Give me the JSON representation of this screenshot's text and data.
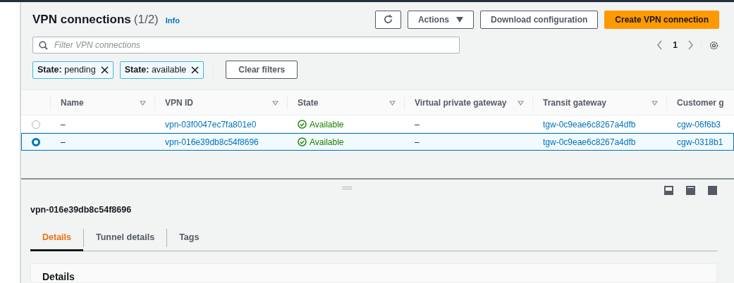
{
  "header": {
    "title": "VPN connections",
    "count": "(1/2)",
    "info": "Info"
  },
  "toolbar": {
    "actions": "Actions",
    "download": "Download configuration",
    "create": "Create VPN connection"
  },
  "search": {
    "placeholder": "Filter VPN connections"
  },
  "pagination": {
    "page": "1"
  },
  "filters": [
    {
      "key": "State:",
      "value": "pending"
    },
    {
      "key": "State:",
      "value": "available"
    }
  ],
  "clear_filters": "Clear filters",
  "table": {
    "columns": [
      "Name",
      "VPN ID",
      "State",
      "Virtual private gateway",
      "Transit gateway",
      "Customer g"
    ],
    "rows": [
      {
        "selected": false,
        "name": "–",
        "vpn_id": "vpn-03f0047ec7fa801e0",
        "state": "Available",
        "vpg": "–",
        "tgw": "tgw-0c9eae6c8267a4dfb",
        "cgw": "cgw-06f6b3"
      },
      {
        "selected": true,
        "name": "–",
        "vpn_id": "vpn-016e39db8c54f8696",
        "state": "Available",
        "vpg": "–",
        "tgw": "tgw-0c9eae6c8267a4dfb",
        "cgw": "cgw-0318b1"
      }
    ]
  },
  "detail": {
    "title": "vpn-016e39db8c54f8696",
    "tabs": [
      {
        "label": "Details",
        "selected": true
      },
      {
        "label": "Tunnel details",
        "selected": false
      },
      {
        "label": "Tags",
        "selected": false
      }
    ],
    "section_title": "Details"
  }
}
